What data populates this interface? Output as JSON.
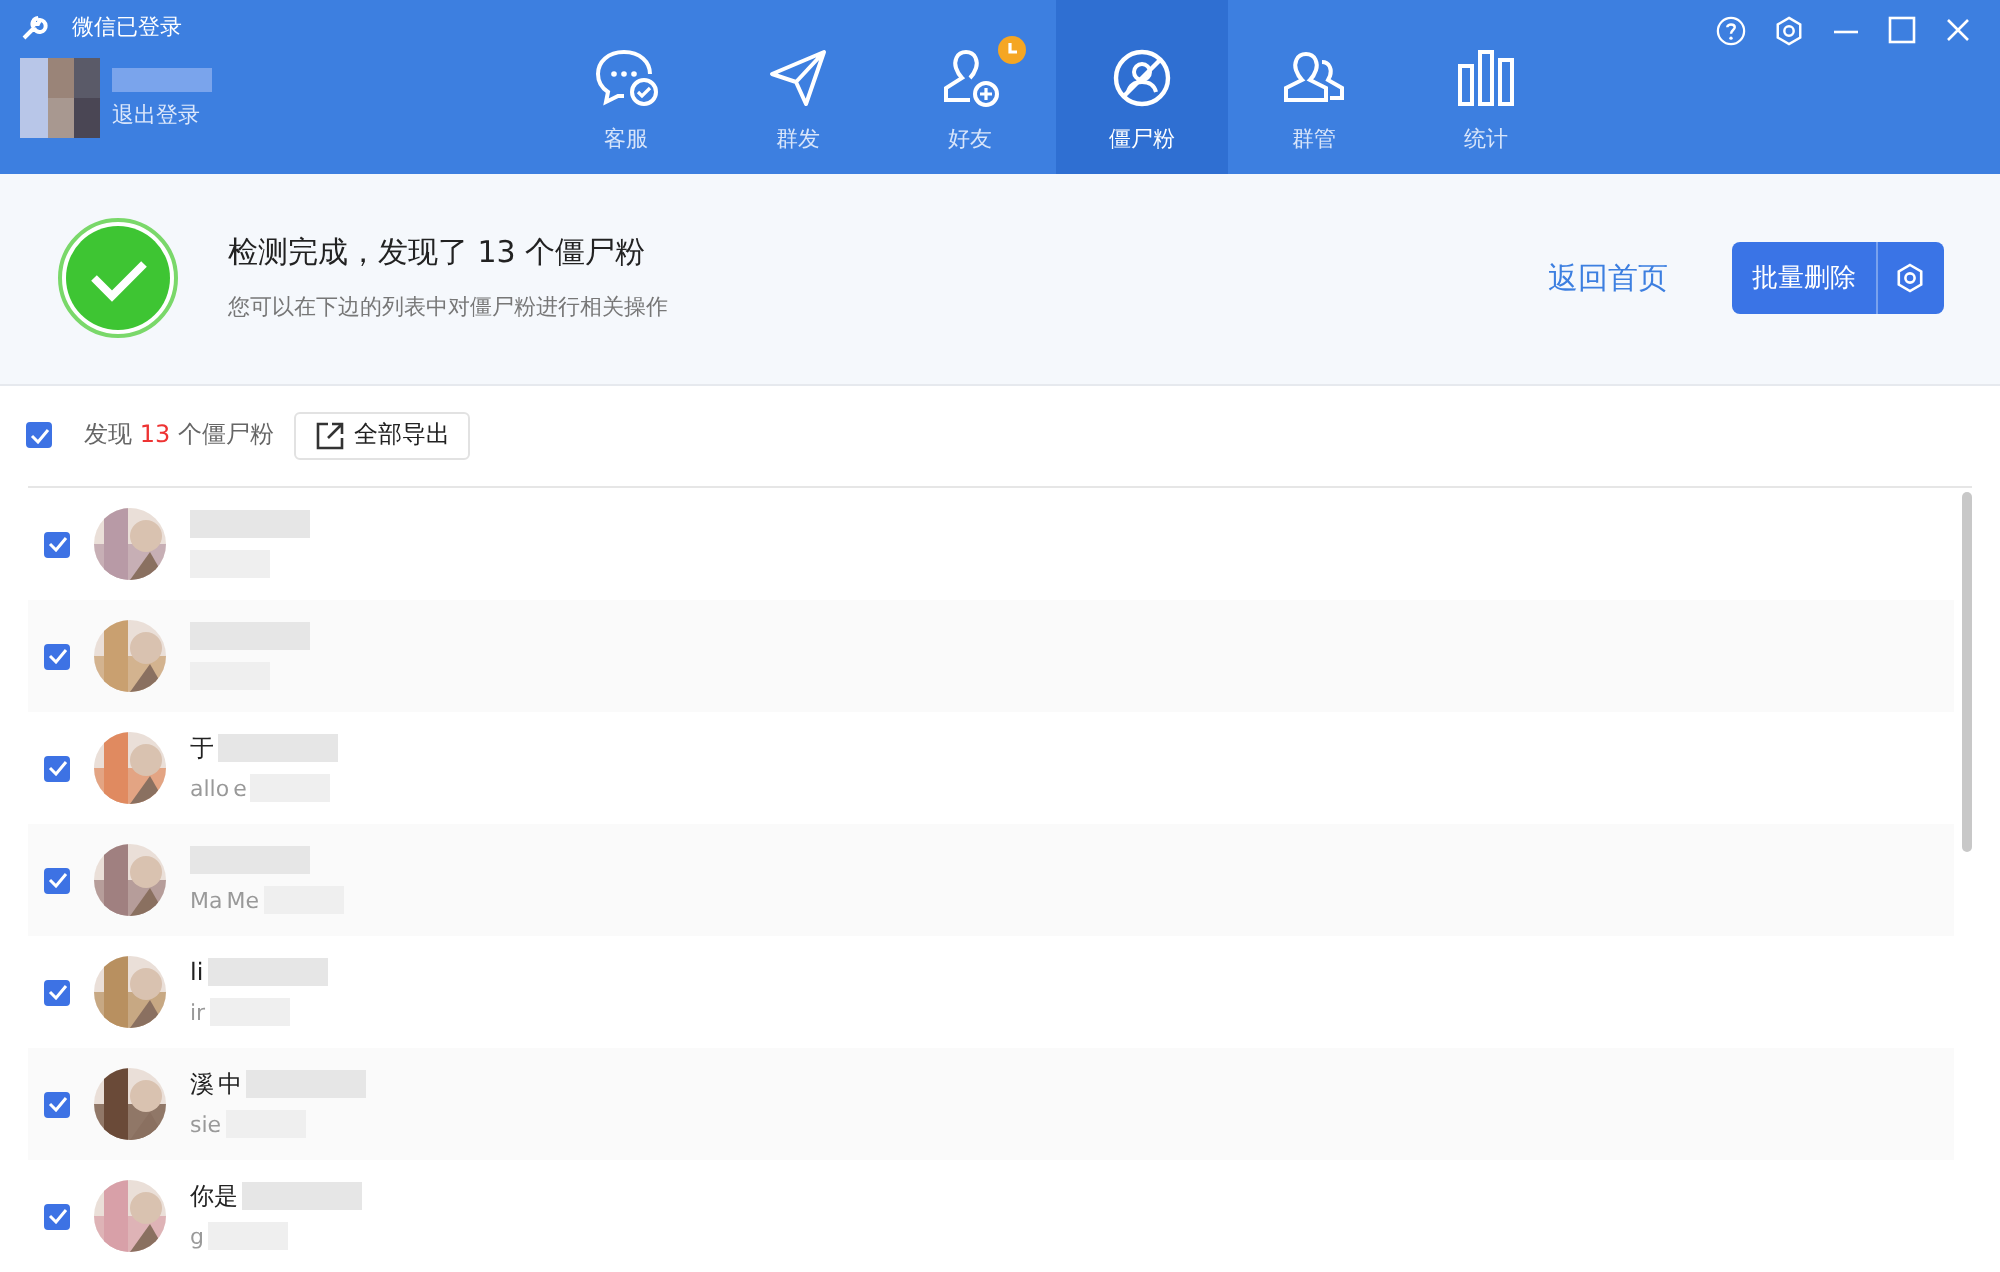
{
  "window": {
    "title": "微信已登录",
    "logout": "退出登录"
  },
  "tabs": [
    {
      "label": "客服",
      "selected": false,
      "badge": false
    },
    {
      "label": "群发",
      "selected": false,
      "badge": false
    },
    {
      "label": "好友",
      "selected": false,
      "badge": true
    },
    {
      "label": "僵尸粉",
      "selected": true,
      "badge": false
    },
    {
      "label": "群管",
      "selected": false,
      "badge": false
    },
    {
      "label": "统计",
      "selected": false,
      "badge": false
    }
  ],
  "result": {
    "title": "检测完成，发现了 13 个僵尸粉",
    "subtitle": "您可以在下边的列表中对僵尸粉进行相关操作",
    "back_link": "返回首页",
    "delete_button": "批量删除"
  },
  "toolbar": {
    "checked": true,
    "prefix": "发现",
    "count": "13",
    "suffix": "个僵尸粉",
    "export_button": "全部导出"
  },
  "rows": [
    {
      "checked": true,
      "name_parts": [],
      "sub_parts": []
    },
    {
      "checked": true,
      "name_parts": [],
      "sub_parts": []
    },
    {
      "checked": true,
      "name_parts": [
        "于"
      ],
      "sub_parts": [
        "allo",
        "e"
      ]
    },
    {
      "checked": true,
      "name_parts": [],
      "sub_parts": [
        "Ma",
        "Me"
      ]
    },
    {
      "checked": true,
      "name_parts": [
        "li"
      ],
      "sub_parts": [
        "ir"
      ]
    },
    {
      "checked": true,
      "name_parts": [
        "溪",
        "中"
      ],
      "sub_parts": [
        "sie"
      ]
    },
    {
      "checked": true,
      "name_parts": [
        "你是"
      ],
      "sub_parts": [
        "g"
      ]
    }
  ]
}
